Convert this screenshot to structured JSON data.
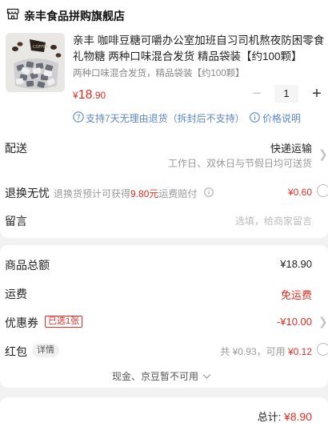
{
  "shop": {
    "name": "亲丰食品拼购旗舰店",
    "icon": "store-icon"
  },
  "product": {
    "title": "亲丰 咖啡豆糖可嚼办公室加班自习司机熬夜防困零食礼物糖 两种口味混合发货 精品袋装【约100颗】",
    "spec": "两种口味混合发货，精品袋装【约100颗】",
    "price_symbol": "¥",
    "price_int": "18",
    "price_dec": ".90",
    "quantity": "1",
    "minus_label": "−",
    "plus_label": "+"
  },
  "guarantee": {
    "text": "支持7天无理由退货（拆封后不支持）",
    "icon_label": "7",
    "price_note": "价格说明",
    "colors": {
      "link": "#5d87c9"
    }
  },
  "delivery": {
    "label": "配送",
    "method": "快递运输",
    "note": "工作日、双休日与节假日均可送货"
  },
  "return": {
    "label": "退换无忧",
    "desc_prefix": "退换货预计可获得",
    "desc_amount": "9.80元",
    "desc_suffix": "运费赔付",
    "price": "¥0.60"
  },
  "message": {
    "label": "留言",
    "placeholder": "选填，给商家留言"
  },
  "summary": {
    "goods_total_label": "商品总额",
    "goods_total_value": "¥18.90",
    "shipping_label": "运费",
    "shipping_value": "免运费",
    "coupon_label": "优惠券",
    "coupon_tag": "已选1张",
    "coupon_value": "-¥10.00",
    "redpacket_label": "红包",
    "redpacket_tag": "详情",
    "redpacket_total": "共 ¥0.93，可用",
    "redpacket_usable": "¥0.12",
    "unavailable_text": "现金、京豆暂不可用",
    "total_label": "总计:",
    "total_value": "¥8.90"
  },
  "colors": {
    "accent": "#e02e24",
    "muted": "#999999",
    "background": "#f2f2f2"
  }
}
